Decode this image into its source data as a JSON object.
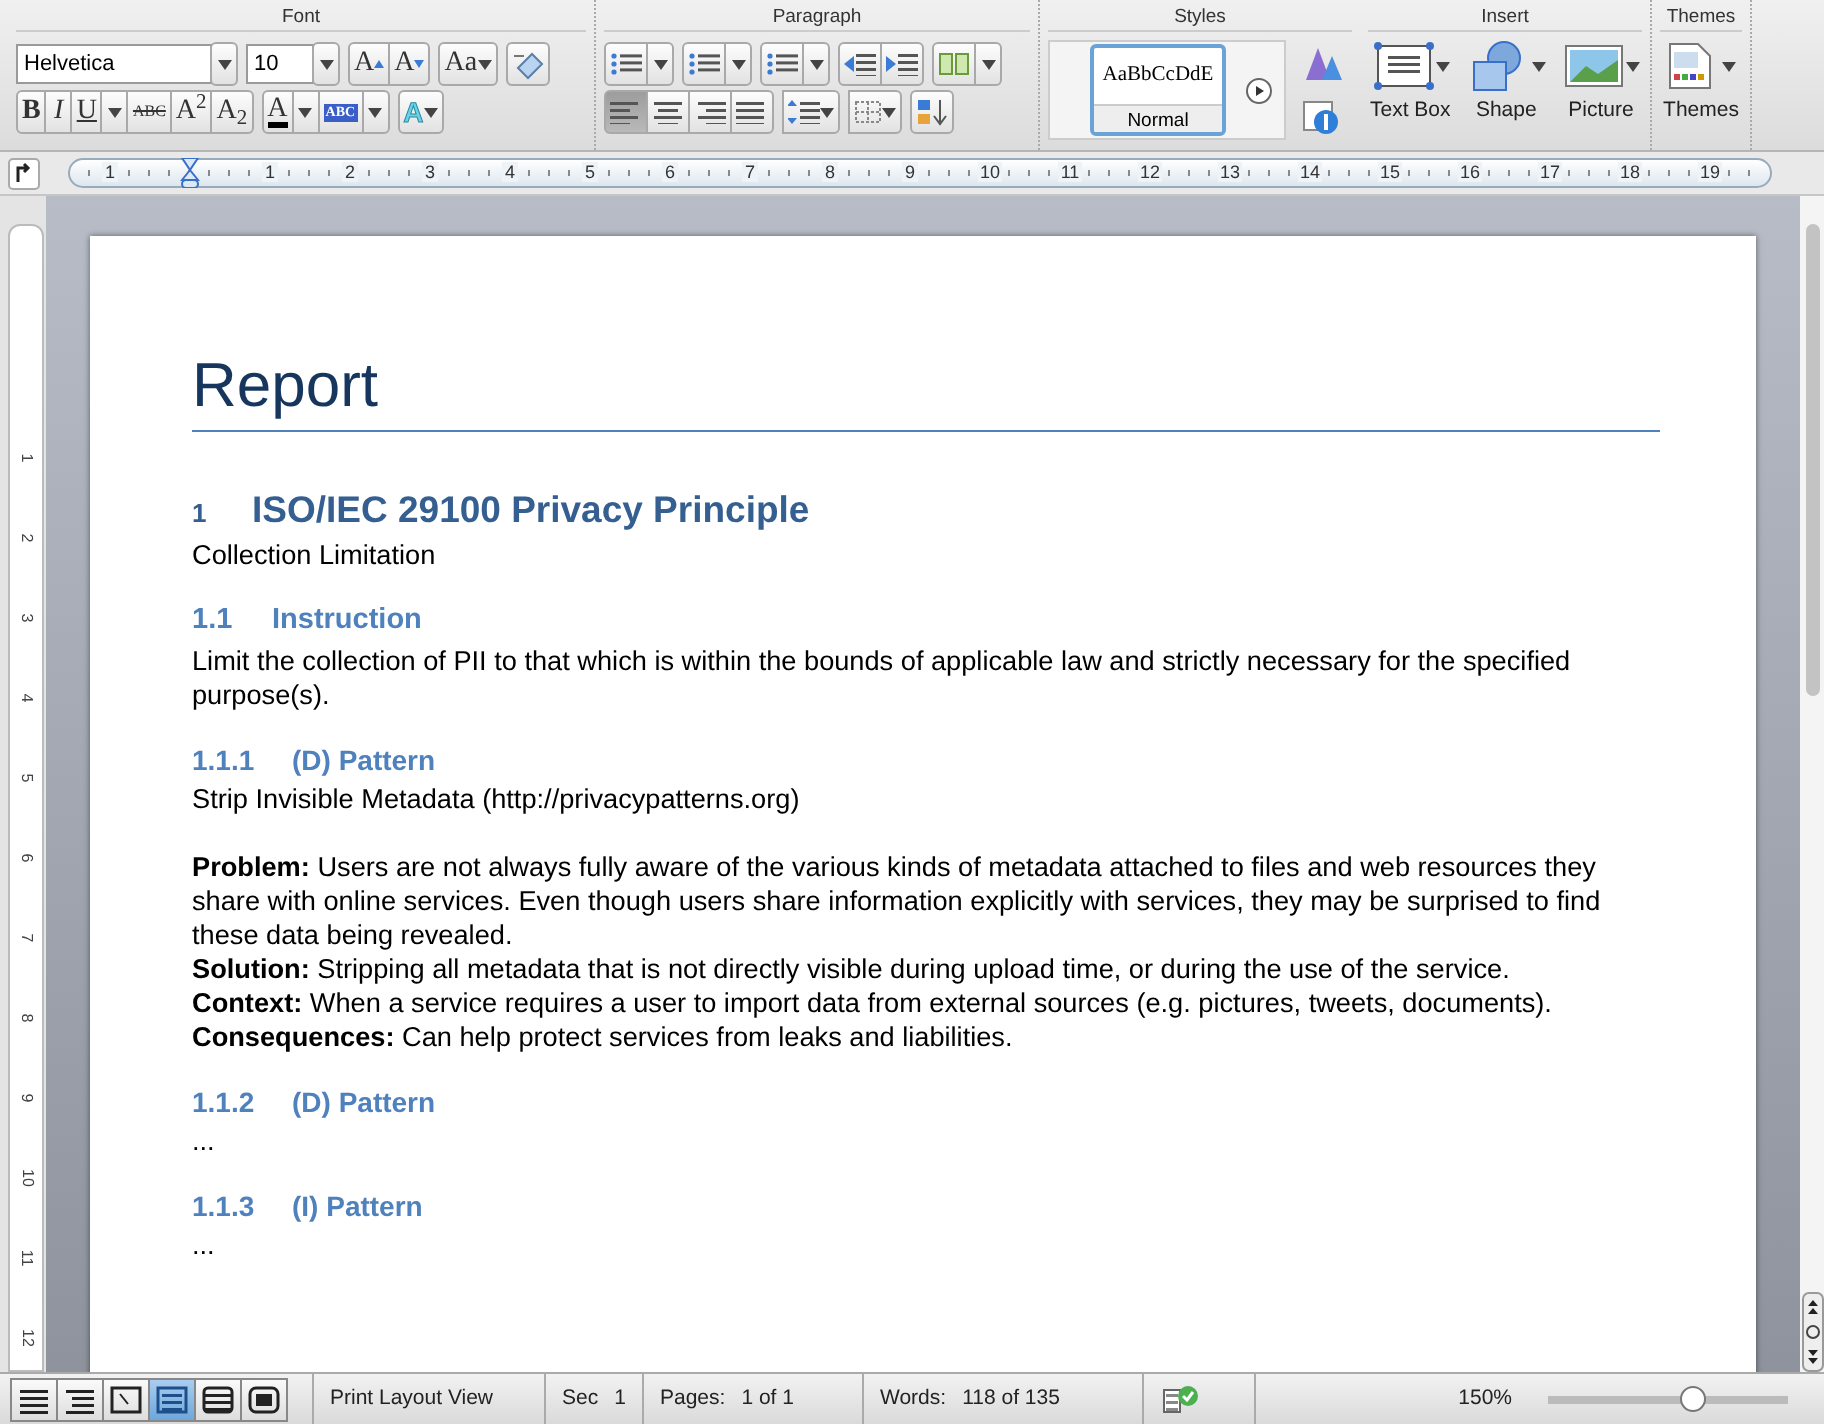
{
  "ribbon": {
    "groups": [
      {
        "title": "Font"
      },
      {
        "title": "Paragraph"
      },
      {
        "title": "Styles"
      },
      {
        "title": "Insert"
      },
      {
        "title": "Themes"
      }
    ],
    "font": {
      "name": "Helvetica",
      "size": "10",
      "grow": "A",
      "shrink": "A",
      "change_case": "Aa",
      "format": [
        "B",
        "I",
        "U",
        "ABC",
        "A$^{2}$",
        "A$_{2}$"
      ],
      "font_color": "A",
      "highlight": "ABC",
      "effects": "A"
    },
    "paragraph": {
      "alignments": [
        {
          "selected": true
        },
        {
          "selected": false
        },
        {
          "selected": false
        },
        {
          "selected": false
        }
      ]
    },
    "styles": {
      "preview": "AaBbCcDdE",
      "name": "Normal"
    },
    "insert": [
      "Text Box",
      "Shape",
      "Picture"
    ],
    "themes": "Themes"
  },
  "ruler": {
    "labels": [
      "1",
      "1",
      "2",
      "3",
      "4",
      "5",
      "6",
      "7",
      "8",
      "9",
      "10",
      "11",
      "12",
      "13",
      "14",
      "15",
      "16",
      "17",
      "18",
      "19"
    ]
  },
  "vertical_ruler": {
    "labels": [
      "1",
      "2",
      "3",
      "4",
      "5",
      "6",
      "7",
      "8",
      "9",
      "10",
      "11",
      "12"
    ]
  },
  "document": {
    "title": "Report",
    "blocks": [
      {
        "kind": "h1",
        "number": "1",
        "text": "ISO/IEC 29100 Privacy Principle"
      },
      {
        "kind": "p",
        "text": "Collection Limitation"
      },
      {
        "kind": "h2",
        "number": "1.1",
        "text": "Instruction"
      },
      {
        "kind": "p",
        "text": "Limit the collection of PII to that which is within the bounds of applicable law and strictly necessary for the specified purpose(s)."
      },
      {
        "kind": "h3",
        "number": "1.1.1",
        "text": "(D) Pattern"
      },
      {
        "kind": "p",
        "text": "Strip Invisible Metadata (http://privacypatterns.org)"
      },
      {
        "kind": "p",
        "space_before": true,
        "text": "**Problem:** Users are not always fully aware of the various kinds of metadata attached to files and web resources they share with online services. Even though users share information explicitly with services, they may be surprised to find these data being revealed."
      },
      {
        "kind": "p",
        "text": "**Solution:** Stripping all metadata that is not directly visible during upload time, or during the use of the service."
      },
      {
        "kind": "p",
        "text": "**Context:** When a service requires a user to import data from external sources (e.g. pictures, tweets, documents)."
      },
      {
        "kind": "p",
        "text": "**Consequences:** Can help protect services from leaks and liabilities."
      },
      {
        "kind": "h3",
        "number": "1.1.2",
        "text": "(D) Pattern"
      },
      {
        "kind": "p",
        "text": "..."
      },
      {
        "kind": "h3",
        "number": "1.1.3",
        "text": "(I) Pattern"
      },
      {
        "kind": "p",
        "text": "..."
      }
    ]
  },
  "status_bar": {
    "views": [
      {
        "selected": false
      },
      {
        "selected": false
      },
      {
        "selected": false
      },
      {
        "selected": true
      },
      {
        "selected": false
      },
      {
        "selected": false
      }
    ],
    "view_name": "Print Layout View",
    "section": {
      "label": "Sec",
      "value": "1"
    },
    "pages": {
      "label": "Pages:",
      "value": "1 of 1"
    },
    "words": {
      "label": "Words:",
      "value": "118 of 135"
    },
    "zoom": {
      "reading": "150%",
      "level": 0.6
    }
  }
}
